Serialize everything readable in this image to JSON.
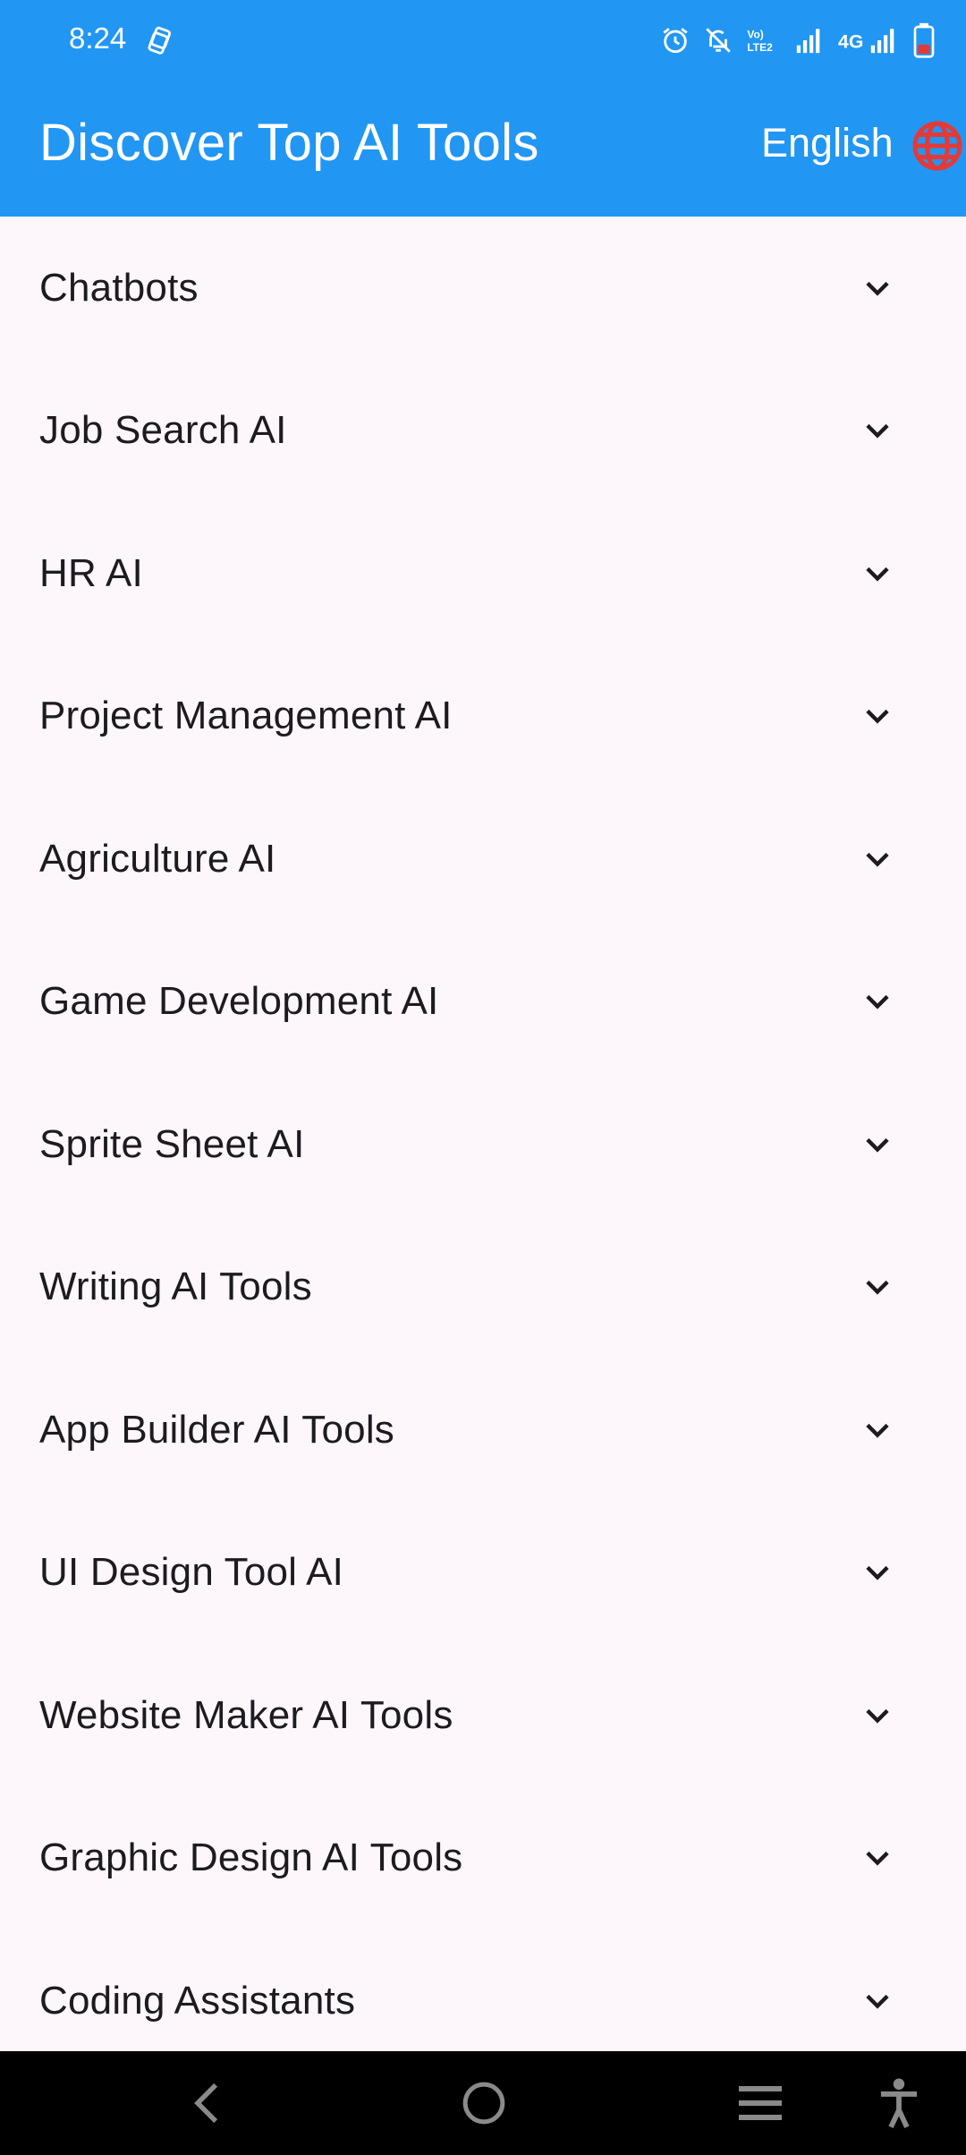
{
  "status_bar": {
    "time": "8:24",
    "icons": [
      "sync-icon",
      "alarm-icon",
      "bell-off-icon",
      "volte-lte2-icon",
      "signal-icon",
      "network-4g-signal-icon",
      "battery-low-icon"
    ],
    "network_label": "4G",
    "volte_label": "VoLTE2"
  },
  "app_bar": {
    "title": "Discover Top AI Tools",
    "language_label": "English",
    "background_color": "#2196F3",
    "globe_color": "#E53935"
  },
  "categories": [
    {
      "label": "Chatbots"
    },
    {
      "label": "Job Search AI"
    },
    {
      "label": "HR AI"
    },
    {
      "label": "Project Management AI"
    },
    {
      "label": "Agriculture AI"
    },
    {
      "label": "Game Development AI"
    },
    {
      "label": "Sprite Sheet AI"
    },
    {
      "label": "Writing AI Tools"
    },
    {
      "label": "App Builder AI Tools"
    },
    {
      "label": "UI Design Tool AI"
    },
    {
      "label": "Website Maker AI Tools"
    },
    {
      "label": "Graphic Design AI Tools"
    },
    {
      "label": "Coding Assistants"
    }
  ],
  "nav_bar": {
    "buttons": [
      "back-icon",
      "home-icon",
      "recents-icon",
      "accessibility-icon"
    ]
  }
}
